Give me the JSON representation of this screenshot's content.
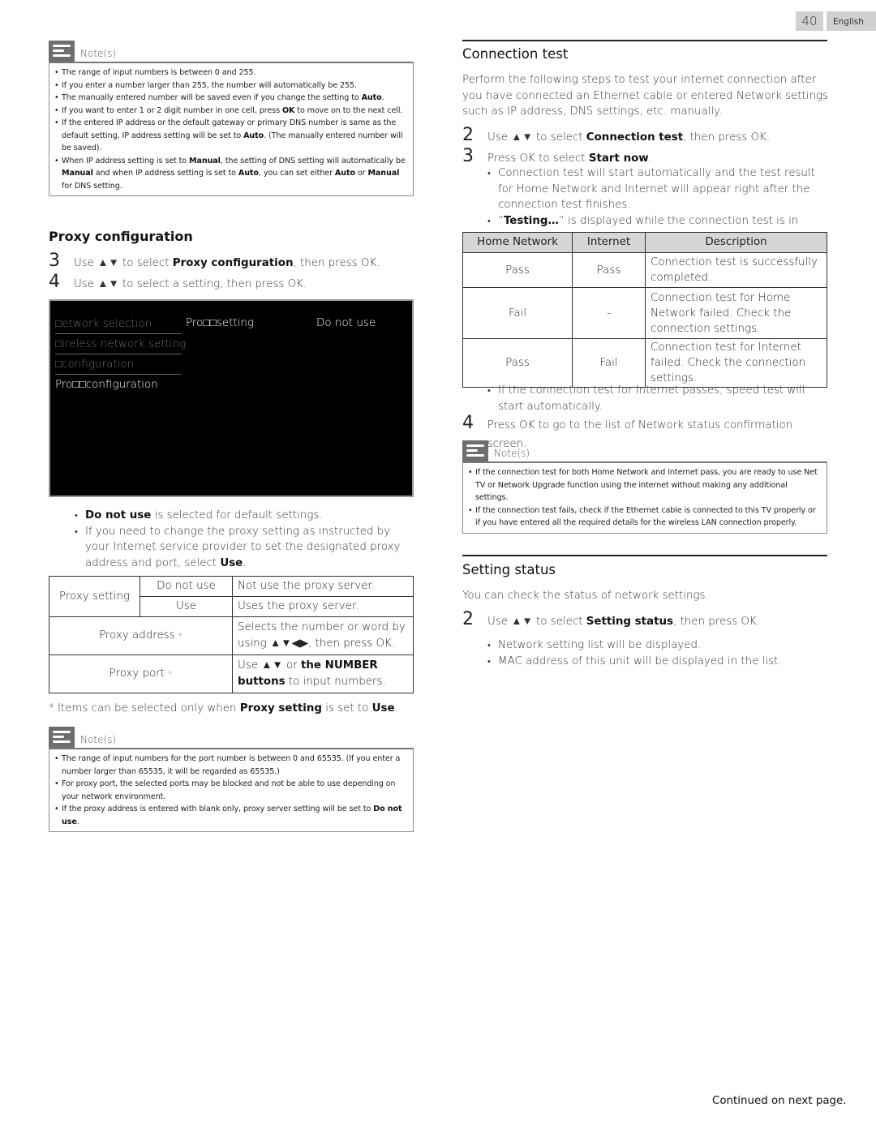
{
  "header": {
    "page_number": "40",
    "language": "English"
  },
  "left": {
    "note1": {
      "label": "Note(s)",
      "items": [
        "The range of input numbers is between 0 and 255.",
        "If you enter a number larger than 255, the number will automatically be 255.",
        [
          "The manually entered number will be saved even if you change the setting to ",
          {
            "b": "Auto"
          },
          "."
        ],
        [
          "If you want to enter 1 or 2 digit number in one cell, press ",
          {
            "b": "OK"
          },
          " to move on to the next cell."
        ],
        [
          "If the entered IP address or the default gateway or primary DNS number is same as the default setting, IP address setting will be set to ",
          {
            "b": "Auto"
          },
          ". (The manually entered number will be saved)."
        ],
        [
          "When IP address setting is set to ",
          {
            "b": "Manual"
          },
          ", the setting of DNS setting will automatically be ",
          {
            "b": "Manual"
          },
          " and when IP address setting is set to ",
          {
            "b": "Auto"
          },
          ", you can set either ",
          {
            "b": "Auto"
          },
          " or ",
          {
            "b": "Manual"
          },
          " for DNS setting."
        ]
      ]
    },
    "proxy_title": "Proxy configuration",
    "steps": [
      {
        "num": "3",
        "parts": [
          "Use ▲▼ to select ",
          {
            "b": "Proxy configuration"
          },
          ", then press OK."
        ]
      },
      {
        "num": "4",
        "parts": [
          "Use ▲▼ to select a setting, then press OK."
        ]
      }
    ],
    "tv_screen": {
      "menu": [
        "□etwork selection",
        "□ireless network setting",
        "□configuration",
        "Pro□□configuration"
      ],
      "active_index": 3,
      "setting_label": "Pro□□setting",
      "setting_value": "Do not use"
    },
    "bullets": [
      [
        {
          "b": "Do not use"
        },
        " is selected for default settings."
      ],
      [
        "If you need to change the proxy setting as instructed by your Internet service provider to set the designated proxy address and port, select ",
        {
          "b": "Use"
        },
        "."
      ]
    ],
    "proxy_table": {
      "proxy_setting": "Proxy setting",
      "do_not_use": "Do not use",
      "do_not_use_desc": "Not use the proxy server.",
      "use": "Use",
      "use_desc": "Uses the proxy server.",
      "proxy_address": "Proxy address",
      "proxy_address_desc": "Selects the number or word by using ▲▼◀▶, then press OK.",
      "proxy_port": "Proxy port",
      "proxy_port_desc": [
        "Use ▲▼ or ",
        {
          "b": "the NUMBER buttons"
        },
        " to input numbers."
      ],
      "asterisk": "*"
    },
    "footnote": [
      "* Items can be selected only when ",
      {
        "b": "Proxy setting"
      },
      " is set to ",
      {
        "b": "Use"
      },
      "."
    ],
    "note2": {
      "label": "Note(s)",
      "items": [
        "The range of input numbers for the port number is between 0 and 65535. (If you enter a number larger than 65535, it will be regarded as 65535.)",
        "For proxy port, the selected ports may be blocked and not be able to use depending on your network environment.",
        [
          "If the proxy address is entered with blank only, proxy server setting will be set to ",
          {
            "b": "Do not use"
          },
          "."
        ]
      ]
    }
  },
  "right": {
    "connection_title": "Connection test",
    "intro": "Perform the following steps to test your internet connection after you have connected an Ethernet cable or entered Network settings such as IP address, DNS settings, etc. manually.",
    "steps": [
      {
        "num": "2",
        "parts": [
          "Use ▲▼ to select ",
          {
            "b": "Connection test"
          },
          ", then press OK."
        ]
      },
      {
        "num": "3",
        "parts": [
          "Press OK to select ",
          {
            "b": "Start now"
          },
          "."
        ]
      }
    ],
    "bullets": [
      [
        "Connection test will start automatically and the test result for Home Network and Internet will appear right after the connection test finishes."
      ],
      [
        "“",
        {
          "b": "Testing…"
        },
        "” is displayed while the connection test is in progress."
      ]
    ],
    "conn_table": {
      "headers": [
        "Home Network",
        "Internet",
        "Description"
      ],
      "rows": [
        [
          "Pass",
          "Pass",
          "Connection test is successfully completed."
        ],
        [
          "Fail",
          "-",
          "Connection test for Home Network failed. Check the connection settings."
        ],
        [
          "Pass",
          "Fail",
          "Connection test for Internet failed. Check the connection settings."
        ]
      ]
    },
    "after_bullets": [
      [
        "If the connection test for Internet passes, speed test will start automatically."
      ]
    ],
    "step4": {
      "num": "4",
      "parts": [
        "Press OK to go to the list of Network status confirmation screen."
      ]
    },
    "note": {
      "label": "Note(s)",
      "items": [
        "If the connection test for both Home Network and Internet pass, you are ready to use Net TV or Network Upgrade function using the internet without making any additional settings.",
        "If the connection test fails, check if the Ethernet cable is connected to this TV properly or if you have entered all the required details for the wireless LAN connection properly."
      ]
    },
    "status_title": "Setting status",
    "status_intro": "You can check the status of network settings.",
    "status_step": {
      "num": "2",
      "parts": [
        "Use ▲▼ to select ",
        {
          "b": "Setting status"
        },
        ", then press OK."
      ]
    },
    "status_bullets": [
      [
        "Network setting list will be displayed."
      ],
      [
        "MAC address of this unit will be displayed in the list."
      ]
    ]
  },
  "footer": {
    "continued": "Continued on next page."
  }
}
